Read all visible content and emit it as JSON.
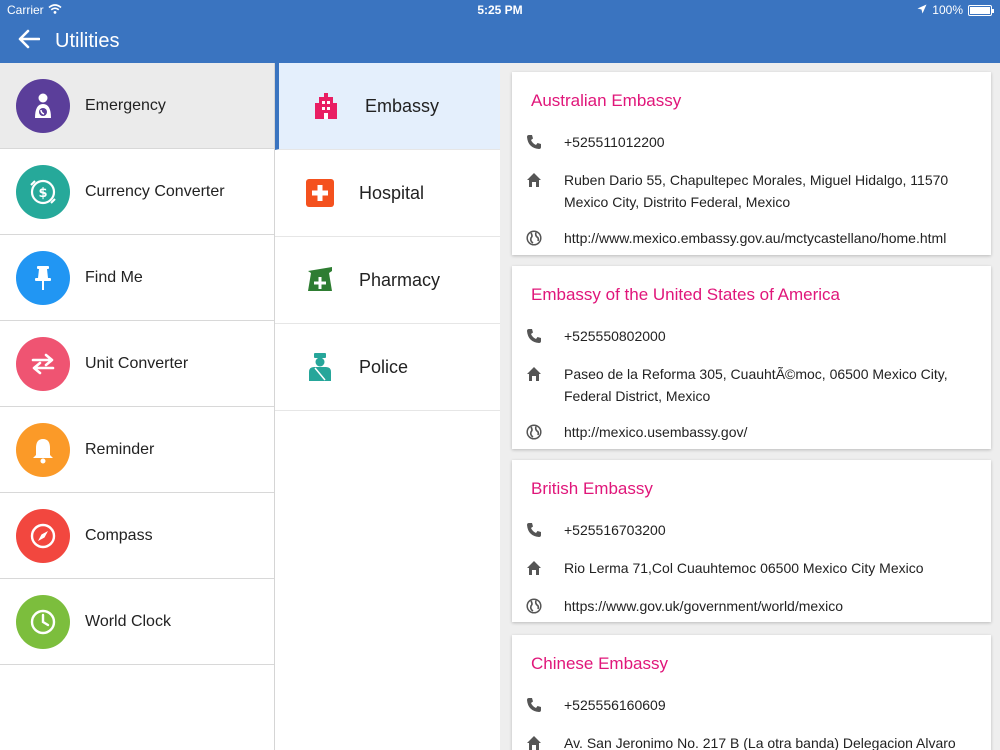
{
  "status": {
    "carrier": "Carrier",
    "time": "5:25 PM",
    "battery": "100%"
  },
  "appbar": {
    "title": "Utilities"
  },
  "menu": [
    {
      "label": "Emergency",
      "icon": "emergency-icon",
      "color": "#5b3e9a",
      "selected": true
    },
    {
      "label": "Currency Converter",
      "icon": "currency-icon",
      "color": "#26a99a"
    },
    {
      "label": "Find Me",
      "icon": "pin-icon",
      "color": "#2196f3"
    },
    {
      "label": "Unit Converter",
      "icon": "swap-arrows-icon",
      "color": "#ef5472"
    },
    {
      "label": "Reminder",
      "icon": "bell-icon",
      "color": "#fb9a28"
    },
    {
      "label": "Compass",
      "icon": "compass-icon",
      "color": "#f2473f"
    },
    {
      "label": "World Clock",
      "icon": "clock-icon",
      "color": "#7cbe3d"
    }
  ],
  "categories": [
    {
      "label": "Embassy",
      "icon": "building-icon",
      "color": "#e91e63",
      "selected": true
    },
    {
      "label": "Hospital",
      "icon": "hospital-cross-icon",
      "color": "#f4511e"
    },
    {
      "label": "Pharmacy",
      "icon": "pharmacy-icon",
      "color": "#2e7d32"
    },
    {
      "label": "Police",
      "icon": "police-icon",
      "color": "#26a69a"
    }
  ],
  "embassies": [
    {
      "name": "Australian Embassy",
      "phone": "+525511012200",
      "address": "Ruben Dario 55, Chapultepec Morales,  Miguel Hidalgo, 11570 Mexico City,  Distrito Federal, Mexico",
      "website": "http://www.mexico.embassy.gov.au/mctycastellano/home.html"
    },
    {
      "name": "Embassy of the United States of America",
      "phone": "+525550802000",
      "address": "Paseo de la Reforma 305, CuauhtÃ©moc, 06500 Mexico City, Federal District, Mexico",
      "website": "http://mexico.usembassy.gov/"
    },
    {
      "name": "British Embassy",
      "phone": "+525516703200",
      "address": "Rio Lerma 71,Col Cuauhtemoc 06500 Mexico City Mexico",
      "website": "https://www.gov.uk/government/world/mexico"
    },
    {
      "name": "Chinese Embassy",
      "phone": "+525556160609",
      "address": "Av. San Jeronimo No. 217 B (La otra banda) Delegacion Alvaro",
      "website": ""
    }
  ],
  "colors": {
    "primary": "#3a74c0",
    "accent": "#e0167a"
  }
}
